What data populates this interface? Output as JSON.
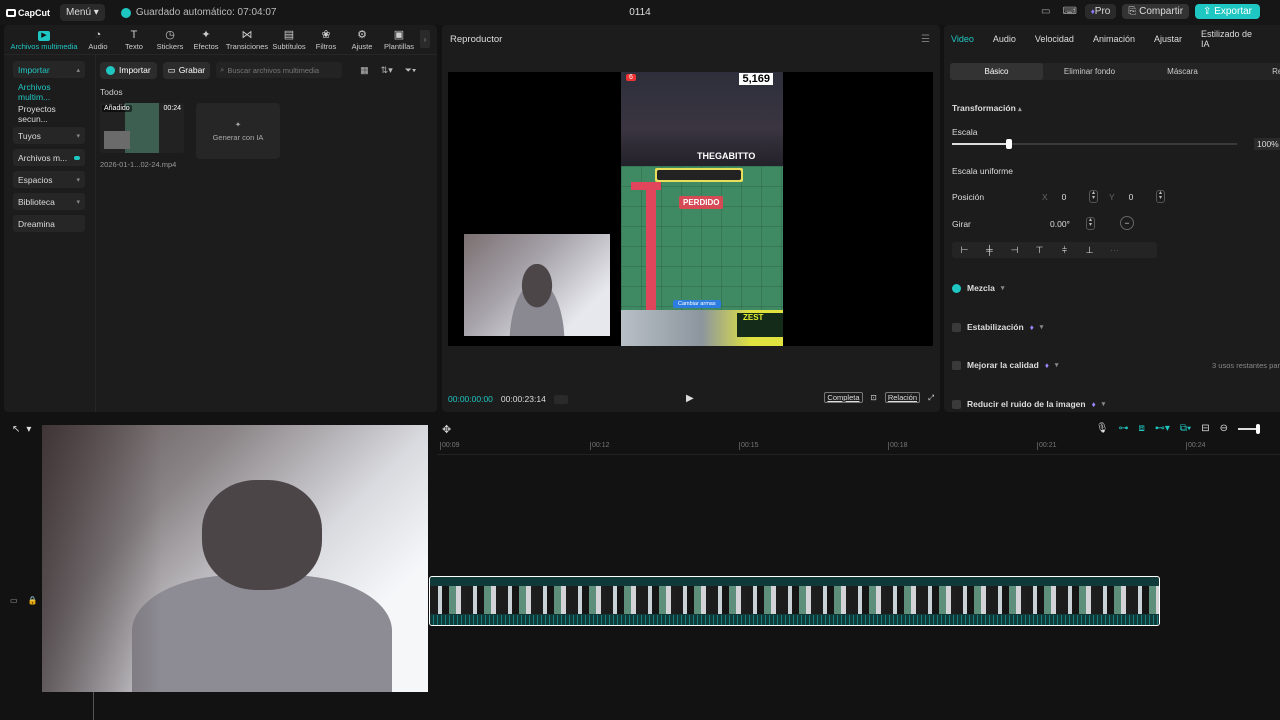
{
  "topbar": {
    "logo": "CapCut",
    "menu_label": "Menú",
    "autosave": "Guardado automático: 07:04:07",
    "project_title": "0114",
    "pro_label": "Pro",
    "share_label": "Compartir",
    "export_label": "Exportar"
  },
  "tool_tabs": [
    {
      "label": "Archivos multimedia",
      "icon": "media-icon"
    },
    {
      "label": "Audio",
      "icon": "audio-icon"
    },
    {
      "label": "Texto",
      "icon": "text-icon"
    },
    {
      "label": "Stickers",
      "icon": "sticker-icon"
    },
    {
      "label": "Efectos",
      "icon": "effects-icon"
    },
    {
      "label": "Transiciones",
      "icon": "transitions-icon"
    },
    {
      "label": "Subtítulos",
      "icon": "subtitles-icon"
    },
    {
      "label": "Filtros",
      "icon": "filters-icon"
    },
    {
      "label": "Ajuste",
      "icon": "adjust-icon"
    },
    {
      "label": "Plantillas",
      "icon": "templates-icon"
    }
  ],
  "side_nav": [
    {
      "label": "Importar"
    },
    {
      "label": "Archivos multim..."
    },
    {
      "label": "Proyectos secun..."
    },
    {
      "label": "Tuyos"
    },
    {
      "label": "Archivos m..."
    },
    {
      "label": "Espacios"
    },
    {
      "label": "Biblioteca"
    },
    {
      "label": "Dreamina"
    }
  ],
  "media": {
    "import_label": "Importar",
    "record_label": "Grabar",
    "search_placeholder": "Buscar archivos multimedia",
    "section_label": "Todos",
    "clip": {
      "badge": "Añadido",
      "duration": "00:24",
      "name": "2026-01-1...02-24.mp4"
    },
    "generate_label": "Generar con IA"
  },
  "player": {
    "title": "Reproductor",
    "current_time": "00:00:00:00",
    "total_time": "00:00:23:14",
    "full_label": "Completa",
    "ratio_label": "Relación",
    "overlay": {
      "counter": "5,169",
      "yt_badge": "6",
      "streamer": "THEGABITTO",
      "lost_text": "PERDIDO",
      "change_btn": "Cambiar armas",
      "brand": "ZEST"
    }
  },
  "inspector": {
    "tabs": [
      "Video",
      "Audio",
      "Velocidad",
      "Animación",
      "Ajustar",
      "Estilizado de IA"
    ],
    "subtabs": [
      "Básico",
      "Eliminar fondo",
      "Máscara",
      "Reto"
    ],
    "transform_label": "Transformación",
    "scale_label": "Escala",
    "scale_value": "100%",
    "scale_fraction": 0.2,
    "uniform_label": "Escala uniforme",
    "position_label": "Posición",
    "pos_x_label": "X",
    "pos_x": "0",
    "pos_y_label": "Y",
    "pos_y": "0",
    "rotate_label": "Girar",
    "rotate_value": "0.00°",
    "blend_label": "Mezcla",
    "stabilize_label": "Estabilización",
    "quality_label": "Mejorar la calidad",
    "quality_note": "3 usos restantes par",
    "denoise_label": "Reducir el ruido de la imagen"
  },
  "timeline": {
    "ruler": [
      "00:09",
      "00:12",
      "00:15",
      "00:18",
      "00:21",
      "00:24"
    ]
  },
  "colors": {
    "accent": "#1fc7c2",
    "panel": "#1c1c1c",
    "background": "#121212"
  }
}
